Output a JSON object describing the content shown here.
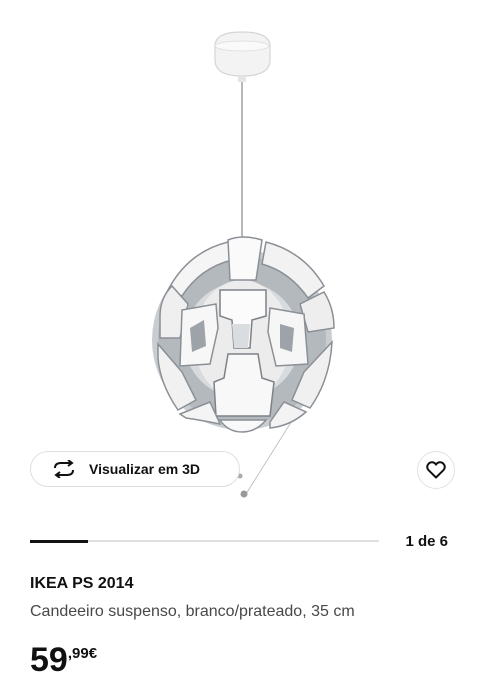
{
  "gallery": {
    "view3d_label": "Visualizar em 3D",
    "pagination": "1 de 6",
    "current_index": 1,
    "total_images": 6,
    "progress_fraction": 0.1667
  },
  "product": {
    "name": "IKEA PS 2014",
    "description": "Candeeiro suspenso, branco/prateado, 35 cm",
    "price_integer": "59",
    "price_decimal": ",99",
    "price_currency": "€"
  },
  "icons": {
    "view3d": "rotate-3d-icon",
    "favorite": "heart-icon",
    "back": "chevron-up-icon"
  },
  "colors": {
    "text": "#111111",
    "secondary_text": "#484848",
    "border": "#dfdfdf",
    "lamp_white": "#f4f4f4",
    "lamp_silver": "#a8adb3"
  }
}
